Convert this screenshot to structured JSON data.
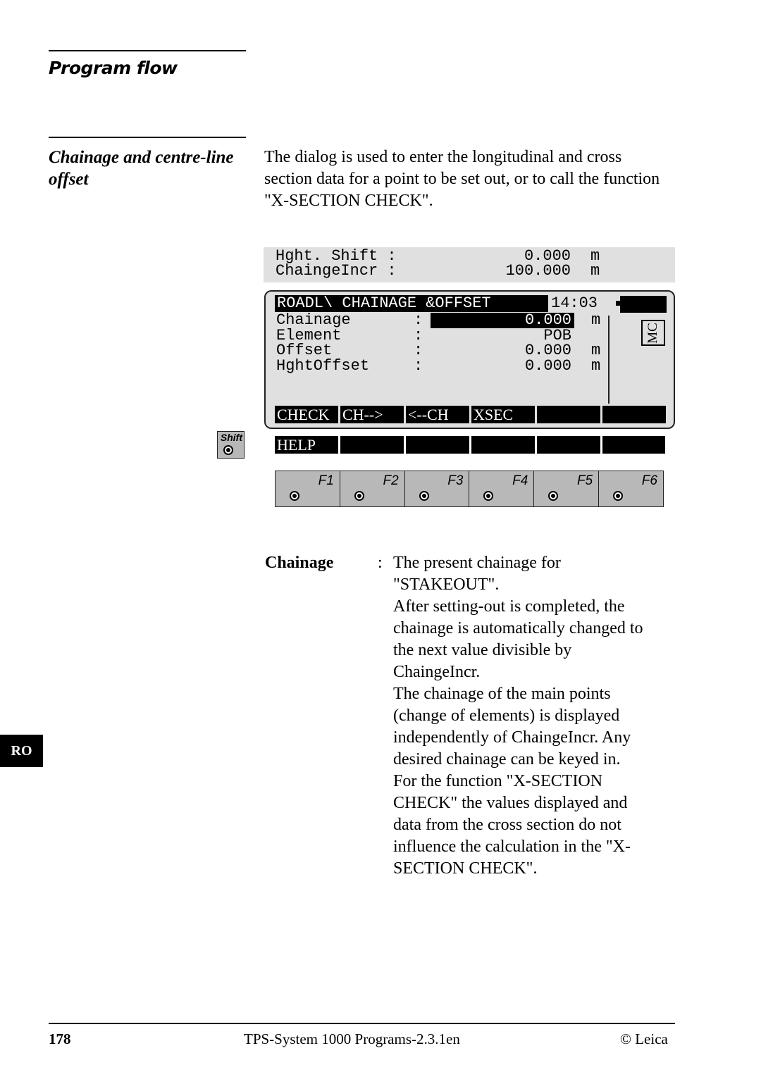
{
  "header": {
    "title": "Program flow"
  },
  "section": {
    "heading": "Chainage and centre-line offset",
    "intro": "The dialog is used to enter the longitudinal and cross section data for a point to be set out, or to call the function \"X-SECTION CHECK\"."
  },
  "top_box": {
    "rows": [
      {
        "label": "Hght. Shift :",
        "value": "0.000",
        "unit": "m"
      },
      {
        "label": "ChaingeIncr :",
        "value": "100.000",
        "unit": "m"
      }
    ]
  },
  "screen": {
    "title": "ROADL\\ CHAINAGE &OFFSET",
    "time": "14:03",
    "mc_badge": "MC",
    "fields": [
      {
        "label": "Chainage",
        "colon": ":",
        "value": "0.000",
        "unit": "m"
      },
      {
        "label": "Element",
        "colon": ":",
        "value": "POB",
        "unit": ""
      },
      {
        "label": "Offset",
        "colon": ":",
        "value": "0.000",
        "unit": "m"
      },
      {
        "label": "HghtOffset",
        "colon": ":",
        "value": "0.000",
        "unit": "m"
      }
    ],
    "softkeys": [
      "CHECK",
      "CH-->",
      "<--CH",
      "XSEC",
      "",
      ""
    ]
  },
  "shift_softkeys": [
    "HELP",
    "",
    "",
    "",
    "",
    ""
  ],
  "shift_key": {
    "label": "Shift"
  },
  "fkeys": [
    "F1",
    "F2",
    "F3",
    "F4",
    "F5",
    "F6"
  ],
  "description": {
    "term": "Chainage",
    "colon": ":",
    "text": [
      "The present chainage for",
      "\"STAKEOUT\".",
      "After setting-out is completed, the",
      "chainage is automatically changed to",
      "the next value divisible by",
      "ChaingeIncr.",
      "The chainage of the main points",
      "(change of elements) is displayed",
      "independently of ChaingeIncr. Any",
      "desired chainage can be keyed in.",
      "For the function \"X-SECTION",
      "CHECK\" the values displayed and",
      "data from the cross section do not",
      "influence the calculation in the \"X-",
      "SECTION CHECK\"."
    ]
  },
  "side_tab": "RO",
  "footer": {
    "page": "178",
    "doc": "TPS-System 1000 Programs-2.3.1en",
    "copyright": "© Leica"
  }
}
